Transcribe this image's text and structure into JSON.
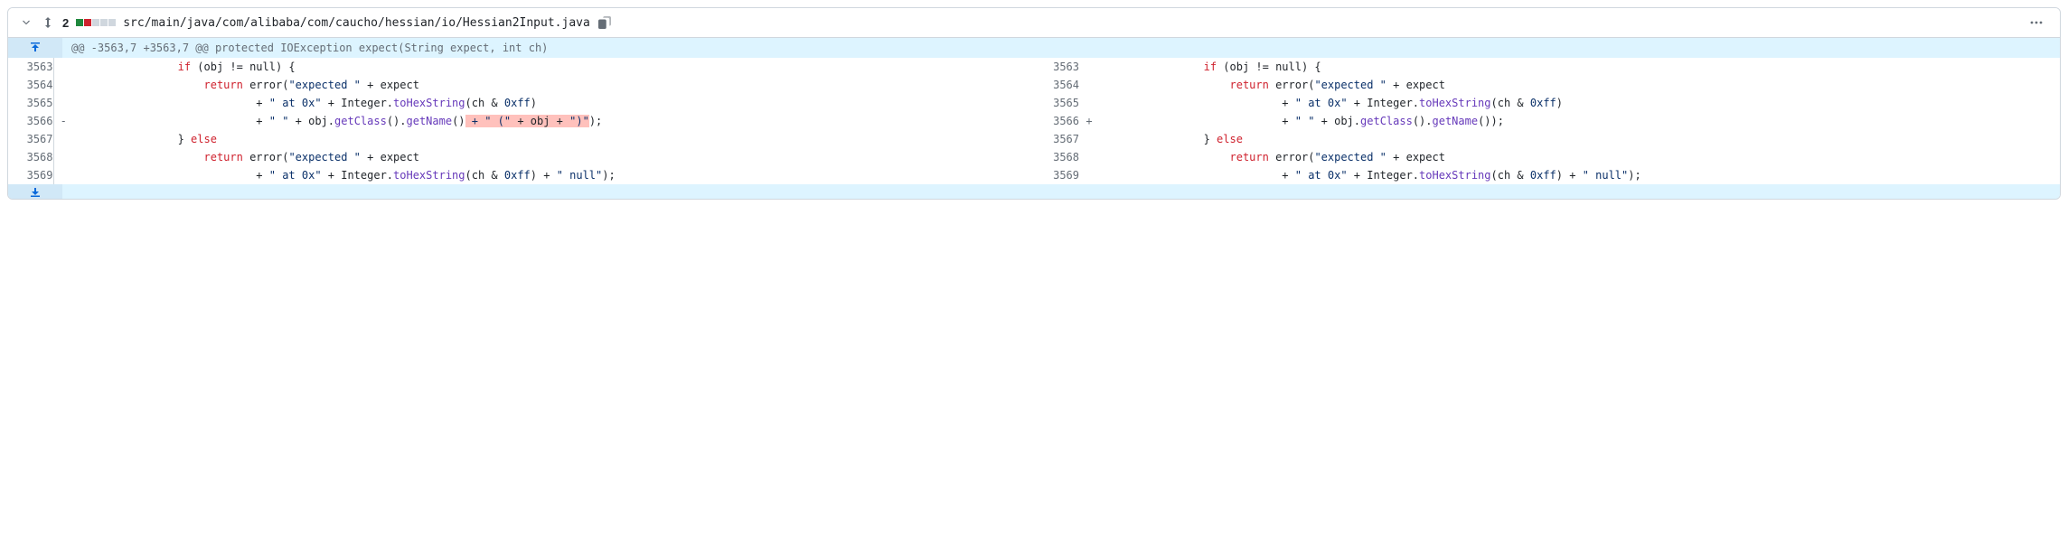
{
  "header": {
    "change_count": "2",
    "file_path": "src/main/java/com/alibaba/com/caucho/hessian/io/Hessian2Input.java"
  },
  "hunk": {
    "text": "@@ -3563,7 +3563,7 @@ protected IOException expect(String expect, int ch)"
  },
  "lines": {
    "l3563": "3563",
    "l3564": "3564",
    "l3565": "3565",
    "l3566": "3566",
    "l3567": "3567",
    "l3568": "3568",
    "l3569": "3569"
  },
  "code": {
    "if_pre": "                ",
    "if_kw": "if",
    "if_post": " (obj != null) {",
    "ret1_pre": "                    ",
    "ret_kw": "return",
    "ret1_mid": " error(",
    "str_expected": "\"expected \"",
    "ret1_post": " + expect",
    "at0x_pre": "                            + ",
    "str_at0x": "\" at 0x\"",
    "at0x_mid": " + Integer.",
    "m_tohex": "toHexString",
    "at0x_post": "(ch & ",
    "hex_ff": "0xff",
    "paren_close": ")",
    "del_pre": "                            + ",
    "str_space": "\" \"",
    "del_mid": " + obj.",
    "m_getclass": "getClass",
    "del_mid2": "().",
    "m_getname": "getName",
    "del_mid3": "()",
    "del_hl1": " + \" (\"",
    "del_hl2": " + obj + ",
    "del_hl3": "\")\"",
    "del_tail": ");",
    "add_tail": "());",
    "else_pre": "                } ",
    "else_kw": "else",
    "ret2_pre": "                    ",
    "ret2_mid": " error(",
    "ret2_post": " + expect",
    "null_line_pre": "                            + ",
    "null_line_mid": " + Integer.",
    "null_line_post": "(ch & ",
    "null_tail_pre": ") + ",
    "str_null": "\" null\"",
    "null_tail_post": ");"
  }
}
